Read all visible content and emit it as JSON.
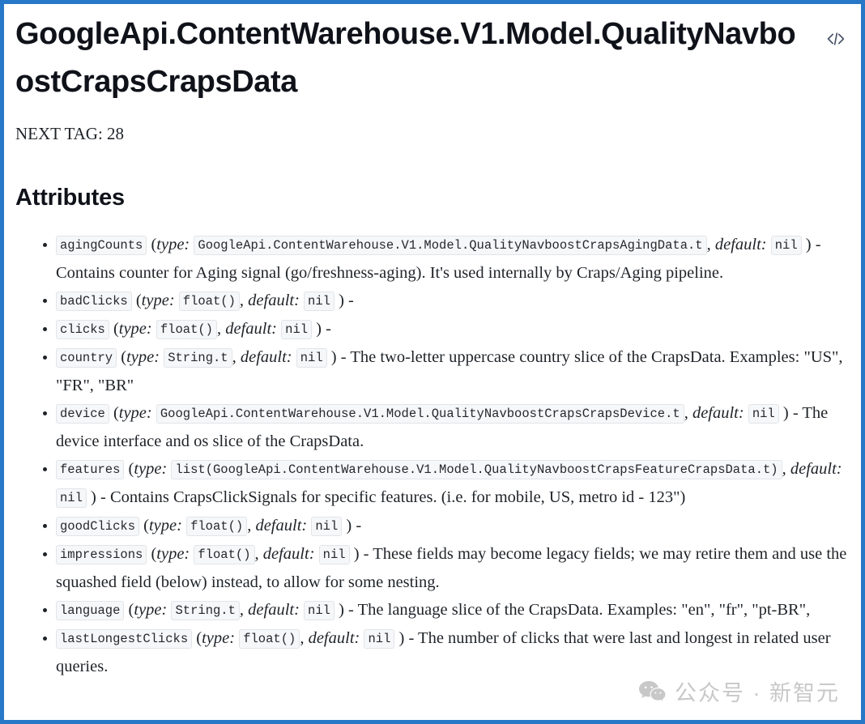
{
  "window": {
    "border_color": "#2878c8",
    "background": "#ffffff"
  },
  "header": {
    "title": "GoogleApi.ContentWarehouse.V1.Model.QualityNavboostCrapsCrapsData",
    "code_icon": "code-brackets-icon",
    "next_tag": "NEXT TAG: 28"
  },
  "sections": {
    "attributes_heading": "Attributes"
  },
  "attributes": [
    {
      "name": "agingCounts",
      "open_paren": "(",
      "type_label": "type:",
      "type": "GoogleApi.ContentWarehouse.V1.Model.QualityNavboostCrapsAgingData.t",
      "comma": ",",
      "default_label": "default:",
      "default": "nil",
      "close_paren": ")",
      "dash": "-",
      "description": "Contains counter for Aging signal (go/freshness-aging). It's used internally by Craps/Aging pipeline."
    },
    {
      "name": "badClicks",
      "open_paren": "(",
      "type_label": "type:",
      "type": "float()",
      "comma": ",",
      "default_label": "default:",
      "default": "nil",
      "close_paren": ")",
      "dash": "-",
      "description": ""
    },
    {
      "name": "clicks",
      "open_paren": "(",
      "type_label": "type:",
      "type": "float()",
      "comma": ",",
      "default_label": "default:",
      "default": "nil",
      "close_paren": ")",
      "dash": "-",
      "description": ""
    },
    {
      "name": "country",
      "open_paren": "(",
      "type_label": "type:",
      "type": "String.t",
      "comma": ",",
      "default_label": "default:",
      "default": "nil",
      "close_paren": ")",
      "dash": "-",
      "description": "The two-letter uppercase country slice of the CrapsData. Examples: \"US\", \"FR\", \"BR\""
    },
    {
      "name": "device",
      "open_paren": "(",
      "type_label": "type:",
      "type": "GoogleApi.ContentWarehouse.V1.Model.QualityNavboostCrapsCrapsDevice.t",
      "comma": ",",
      "default_label": "default:",
      "default": "nil",
      "close_paren": ")",
      "dash": "-",
      "description": "The device interface and os slice of the CrapsData."
    },
    {
      "name": "features",
      "open_paren": "(",
      "type_label": "type:",
      "type": "list(GoogleApi.ContentWarehouse.V1.Model.QualityNavboostCrapsFeatureCrapsData.t)",
      "comma": ",",
      "default_label": "default:",
      "default": "nil",
      "close_paren": ")",
      "dash": "-",
      "description": "Contains CrapsClickSignals for specific features. (i.e. for mobile, US, metro id - 123\")"
    },
    {
      "name": "goodClicks",
      "open_paren": "(",
      "type_label": "type:",
      "type": "float()",
      "comma": ",",
      "default_label": "default:",
      "default": "nil",
      "close_paren": ")",
      "dash": "-",
      "description": ""
    },
    {
      "name": "impressions",
      "open_paren": "(",
      "type_label": "type:",
      "type": "float()",
      "comma": ",",
      "default_label": "default:",
      "default": "nil",
      "close_paren": ")",
      "dash": "-",
      "description": "These fields may become legacy fields; we may retire them and use the squashed field (below) instead, to allow for some nesting."
    },
    {
      "name": "language",
      "open_paren": "(",
      "type_label": "type:",
      "type": "String.t",
      "comma": ",",
      "default_label": "default:",
      "default": "nil",
      "close_paren": ")",
      "dash": "-",
      "description": "The language slice of the CrapsData. Examples: \"en\", \"fr\", \"pt-BR\","
    },
    {
      "name": "lastLongestClicks",
      "open_paren": "(",
      "type_label": "type:",
      "type": "float()",
      "comma": ",",
      "default_label": "default:",
      "default": "nil",
      "close_paren": ")",
      "dash": "-",
      "description": "The number of clicks that were last and longest in related user queries."
    }
  ],
  "watermark": {
    "icon": "wechat-bubble-icon",
    "text": "公众号 · 新智元"
  }
}
